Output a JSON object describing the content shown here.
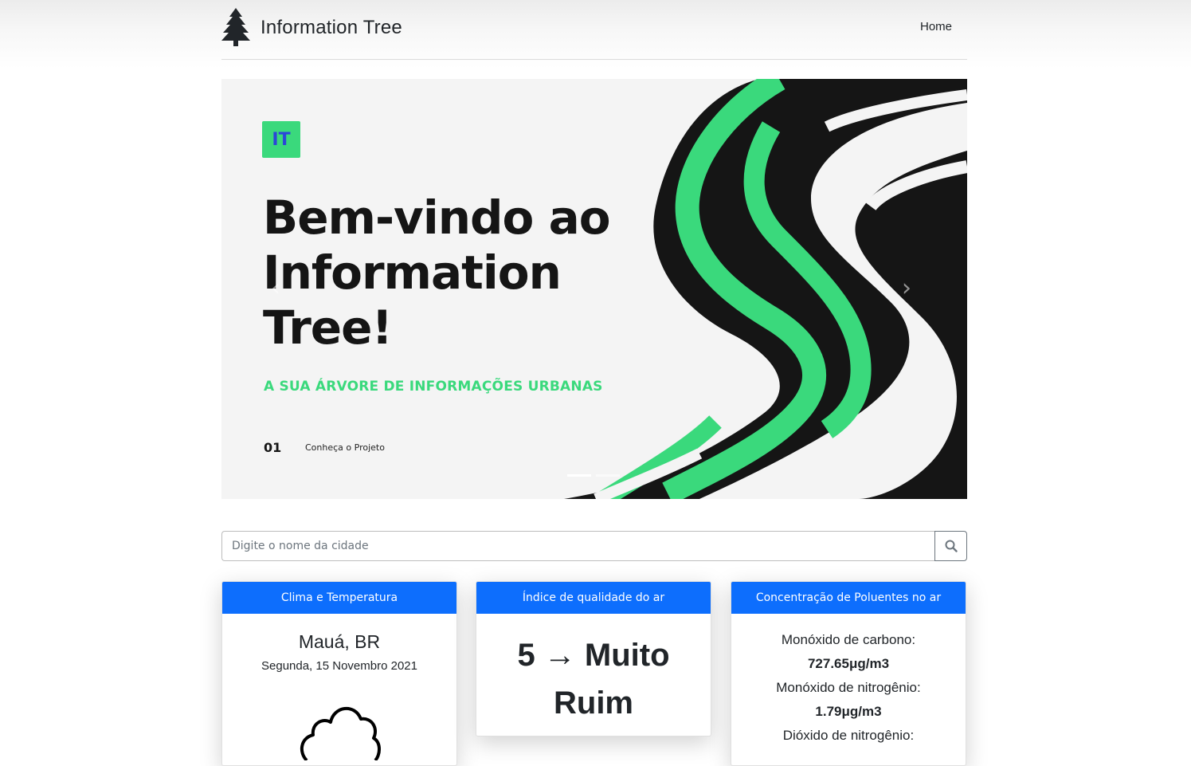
{
  "header": {
    "brand_name": "Information Tree",
    "nav": {
      "home": "Home"
    }
  },
  "carousel": {
    "badge": "IT",
    "title": "Bem-vindo ao Information Tree!",
    "subtitle": "A SUA ÁRVORE DE INFORMAÇÕES URBANAS",
    "slide_number": "01",
    "cta": "Conheça o Projeto",
    "prev_icon": "‹",
    "next_icon": "›",
    "slides_total": 2,
    "active_slide": 1
  },
  "search": {
    "placeholder": "Digite o nome da cidade",
    "value": "",
    "button_icon": "search-icon"
  },
  "cards": {
    "weather": {
      "header": "Clima e Temperatura",
      "city": "Mauá, BR",
      "date": "Segunda, 15 Novembro 2021",
      "icon": "cloud-icon"
    },
    "air_quality": {
      "header": "Índice de qualidade do ar",
      "value": "5 → Muito Ruim"
    },
    "pollutants": {
      "header": "Concentração de Poluentes no ar",
      "items": [
        {
          "name": "Monóxido de carbono:",
          "value": "727.65μg/m3"
        },
        {
          "name": "Monóxido de nitrogênio:",
          "value": "1.79μg/m3"
        },
        {
          "name": "Dióxido de nitrogênio:",
          "value": ""
        }
      ]
    }
  },
  "colors": {
    "primary": "#0d6efd",
    "accent_green": "#3ad97c",
    "dark": "#151515",
    "slide_background": "#f4f4f4"
  }
}
